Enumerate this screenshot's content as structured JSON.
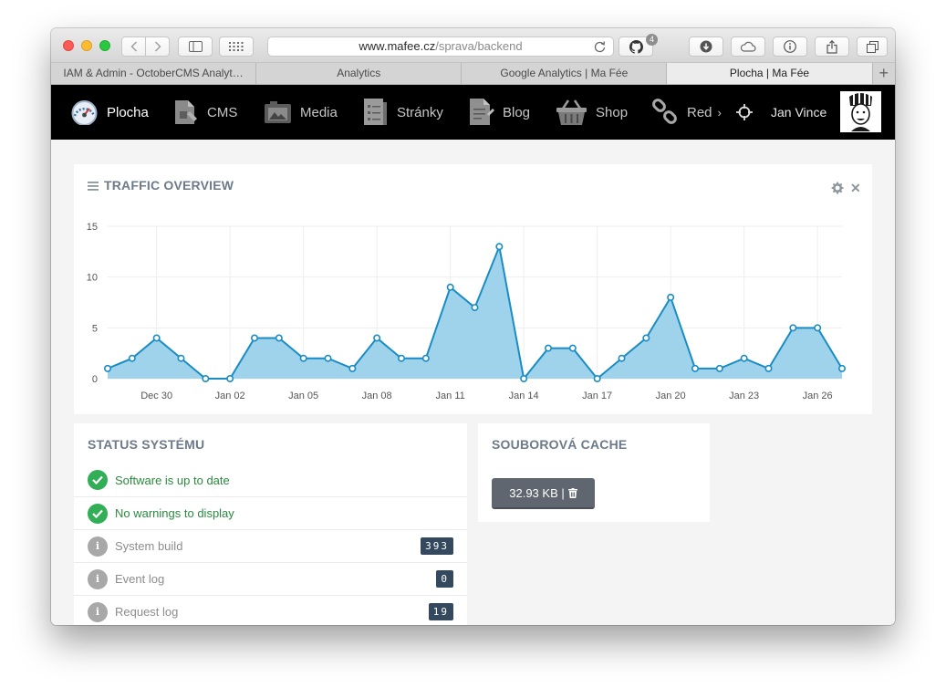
{
  "browser": {
    "url_domain": "www.mafee.cz",
    "url_path": "/sprava/backend",
    "github_badge": "4",
    "tabs": [
      {
        "label": "IAM & Admin - OctoberCMS Analyt…",
        "active": false
      },
      {
        "label": "Analytics",
        "active": false
      },
      {
        "label": "Google Analytics | Ma Fée",
        "active": false
      },
      {
        "label": "Plocha | Ma Fée",
        "active": true
      }
    ]
  },
  "nav": {
    "items": [
      {
        "label": "Plocha",
        "icon": "dashboard-gauge-icon",
        "active": true
      },
      {
        "label": "CMS",
        "icon": "cms-icon",
        "active": false
      },
      {
        "label": "Media",
        "icon": "media-icon",
        "active": false
      },
      {
        "label": "Stránky",
        "icon": "pages-icon",
        "active": false
      },
      {
        "label": "Blog",
        "icon": "blog-icon",
        "active": false
      },
      {
        "label": "Shop",
        "icon": "shopping-basket-icon",
        "active": false
      },
      {
        "label": "Red",
        "icon": "link-icon",
        "active": false
      }
    ],
    "more_arrow": "›",
    "user_name": "Jan Vince"
  },
  "traffic": {
    "title": "TRAFFIC OVERVIEW"
  },
  "chart_data": {
    "type": "area",
    "title": "TRAFFIC OVERVIEW",
    "xlabel": "",
    "ylabel": "",
    "ylim": [
      0,
      15
    ],
    "yticks": [
      0,
      5,
      10,
      15
    ],
    "x": [
      "Dec 28",
      "Dec 29",
      "Dec 30",
      "Dec 31",
      "Jan 01",
      "Jan 02",
      "Jan 03",
      "Jan 04",
      "Jan 05",
      "Jan 06",
      "Jan 07",
      "Jan 08",
      "Jan 09",
      "Jan 10",
      "Jan 11",
      "Jan 12",
      "Jan 13",
      "Jan 14",
      "Jan 15",
      "Jan 16",
      "Jan 17",
      "Jan 18",
      "Jan 19",
      "Jan 20",
      "Jan 21",
      "Jan 22",
      "Jan 23",
      "Jan 24",
      "Jan 25",
      "Jan 26",
      "Jan 27"
    ],
    "xtick_labels": [
      "Dec 30",
      "Jan 02",
      "Jan 05",
      "Jan 08",
      "Jan 11",
      "Jan 14",
      "Jan 17",
      "Jan 20",
      "Jan 23",
      "Jan 26"
    ],
    "values": [
      1,
      2,
      4,
      2,
      0,
      0,
      4,
      4,
      2,
      2,
      1,
      4,
      2,
      2,
      9,
      7,
      13,
      0,
      3,
      3,
      0,
      2,
      4,
      8,
      1,
      1,
      2,
      1,
      5,
      5,
      1
    ],
    "grid": true,
    "colors": {
      "fill": "#9fd3ec",
      "line": "#1a8cc4",
      "grid": "#eeeeee"
    }
  },
  "status": {
    "title": "STATUS SYSTÉMU",
    "rows": [
      {
        "label": "Software is up to date",
        "kind": "ok"
      },
      {
        "label": "No warnings to display",
        "kind": "ok"
      },
      {
        "label": "System build",
        "kind": "info",
        "count": "393"
      },
      {
        "label": "Event log",
        "kind": "info",
        "count": "0"
      },
      {
        "label": "Request log",
        "kind": "info",
        "count": "19"
      }
    ]
  },
  "cache": {
    "title": "SOUBOROVÁ CACHE",
    "size": "32.93 KB |"
  }
}
